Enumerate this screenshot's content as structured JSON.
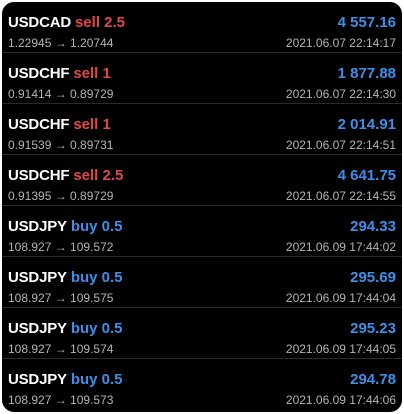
{
  "colors": {
    "sell": "#e04848",
    "buy": "#3d8fe8",
    "profit": "#3d8fe8",
    "background": "#000000",
    "muted_text": "#b4b4b4"
  },
  "trades": [
    {
      "symbol": "USDCAD",
      "action": "sell 2.5",
      "side": "sell",
      "prices": "1.22945 → 1.20744",
      "profit": "4 557.16",
      "time": "2021.06.07 22:14:17"
    },
    {
      "symbol": "USDCHF",
      "action": "sell 1",
      "side": "sell",
      "prices": "0.91414 → 0.89729",
      "profit": "1 877.88",
      "time": "2021.06.07 22:14:30"
    },
    {
      "symbol": "USDCHF",
      "action": "sell 1",
      "side": "sell",
      "prices": "0.91539 → 0.89731",
      "profit": "2 014.91",
      "time": "2021.06.07 22:14:51"
    },
    {
      "symbol": "USDCHF",
      "action": "sell 2.5",
      "side": "sell",
      "prices": "0.91395 → 0.89729",
      "profit": "4 641.75",
      "time": "2021.06.07 22:14:55"
    },
    {
      "symbol": "USDJPY",
      "action": "buy 0.5",
      "side": "buy",
      "prices": "108.927 → 109.572",
      "profit": "294.33",
      "time": "2021.06.09 17:44:02"
    },
    {
      "symbol": "USDJPY",
      "action": "buy 0.5",
      "side": "buy",
      "prices": "108.927 → 109.575",
      "profit": "295.69",
      "time": "2021.06.09 17:44:04"
    },
    {
      "symbol": "USDJPY",
      "action": "buy 0.5",
      "side": "buy",
      "prices": "108.927 → 109.574",
      "profit": "295.23",
      "time": "2021.06.09 17:44:05"
    },
    {
      "symbol": "USDJPY",
      "action": "buy 0.5",
      "side": "buy",
      "prices": "108.927 → 109.573",
      "profit": "294.78",
      "time": "2021.06.09 17:44:06"
    }
  ]
}
